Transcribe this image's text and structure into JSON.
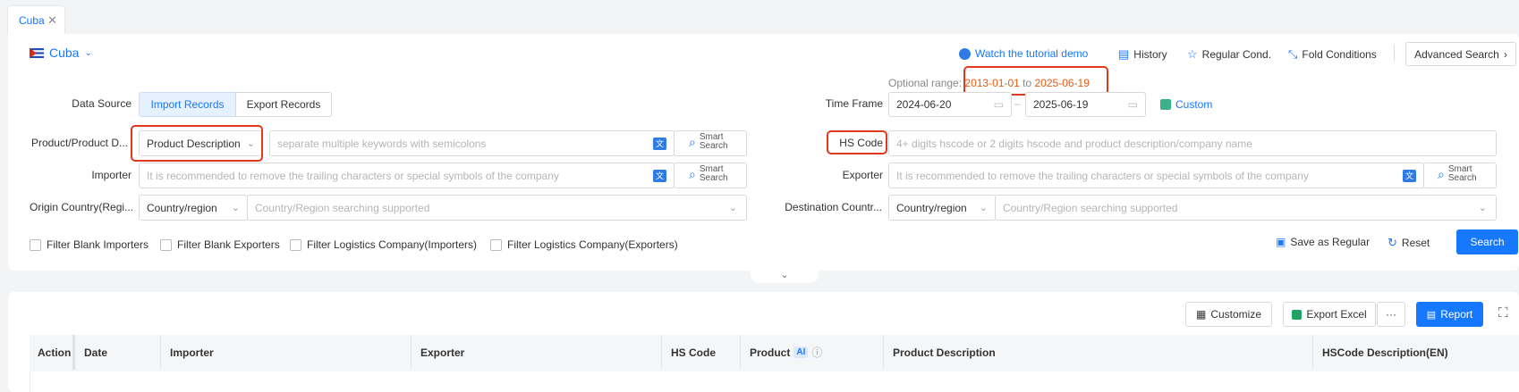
{
  "tab": {
    "label": "Cuba",
    "close": "✕"
  },
  "country": {
    "name": "Cuba"
  },
  "toolbar": {
    "tutorial": "Watch the tutorial demo",
    "history": "History",
    "regular_cond": "Regular Cond.",
    "fold_conditions": "Fold Conditions",
    "advanced_search": "Advanced Search"
  },
  "data_source": {
    "label": "Data Source",
    "import": "Import Records",
    "export": "Export Records"
  },
  "time_frame": {
    "optional_label": "Optional range:",
    "range_start": "2013-01-01",
    "range_to": "to",
    "range_end": "2025-06-19",
    "label": "Time Frame",
    "start": "2024-06-20",
    "end": "2025-06-19",
    "custom": "Custom"
  },
  "product": {
    "label": "Product/Product D...",
    "select": "Product Description",
    "placeholder": "separate multiple keywords with semicolons",
    "smart1": "Smart",
    "smart2": "Search"
  },
  "hs_code": {
    "label": "HS Code",
    "placeholder": "4+ digits hscode or 2 digits hscode and product description/company name"
  },
  "importer": {
    "label": "Importer",
    "placeholder": "It is recommended to remove the trailing characters or special symbols of the company",
    "smart1": "Smart",
    "smart2": "Search"
  },
  "exporter": {
    "label": "Exporter",
    "placeholder": "It is recommended to remove the trailing characters or special symbols of the company",
    "smart1": "Smart",
    "smart2": "Search"
  },
  "origin": {
    "label": "Origin Country(Regi...",
    "select": "Country/region",
    "placeholder": "Country/Region searching supported"
  },
  "destination": {
    "label": "Destination Countr...",
    "select": "Country/region",
    "placeholder": "Country/Region searching supported"
  },
  "filters": [
    "Filter Blank Importers",
    "Filter Blank Exporters",
    "Filter Logistics Company(Importers)",
    "Filter Logistics Company(Exporters)"
  ],
  "actions": {
    "save_regular": "Save as Regular",
    "reset": "Reset",
    "search": "Search"
  },
  "results_toolbar": {
    "customize": "Customize",
    "export_excel": "Export Excel",
    "more": "···",
    "report": "Report"
  },
  "table": {
    "headers": [
      "Action",
      "Date",
      "Importer",
      "Exporter",
      "HS Code",
      "Product",
      "Product Description",
      "HSCode Description(EN)"
    ],
    "ai_badge": "AI"
  },
  "colors": {
    "accent": "#1677ff",
    "highlight_orange": "#e8590c",
    "annotation_red": "#e0391e"
  }
}
